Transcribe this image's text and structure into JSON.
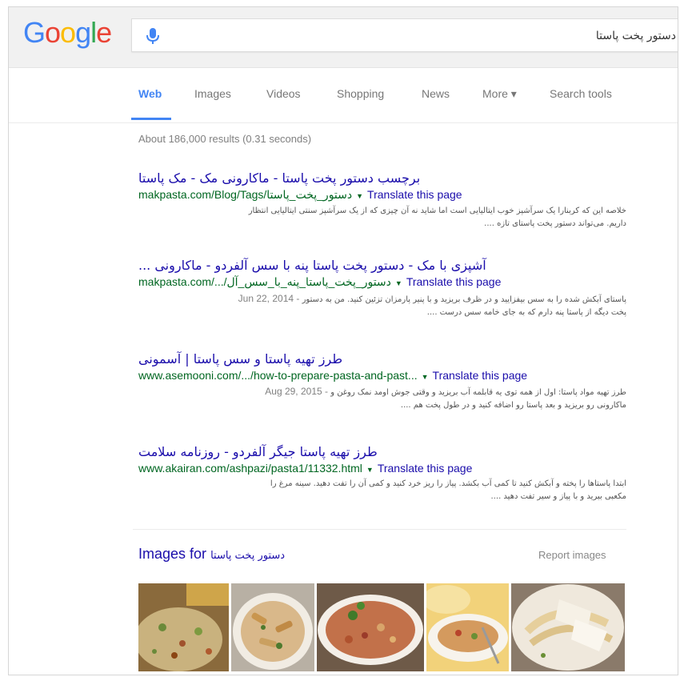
{
  "logo": "Google",
  "search": {
    "query": "دستور پخت پاستا"
  },
  "tabs": [
    {
      "label": "Web",
      "active": true
    },
    {
      "label": "Images",
      "active": false
    },
    {
      "label": "Videos",
      "active": false
    },
    {
      "label": "Shopping",
      "active": false
    },
    {
      "label": "News",
      "active": false
    },
    {
      "label": "More ▾",
      "active": false
    },
    {
      "label": "Search tools",
      "active": false
    }
  ],
  "result_stats": "About 186,000 results (0.31 seconds)",
  "results": [
    {
      "title": "برچسب دستور پخت پاستا - ماکارونی مک - مک پاستا",
      "url": "makpasta.com/Blog/Tags/دستور_پخت_پاستا",
      "translate": "Translate this page",
      "date": "",
      "snippet1": "خلاصه این که کربنارا یک سرآشپز خوب ایتالیایی است اما شاید نه آن چیزی که از یک سرآشپز سنتی ایتالیایی انتظار",
      "snippet2": "داریم. می‌تواند دستور پخت پاستای تازه ...."
    },
    {
      "title": "آشپزی با مک - دستور پخت پاستا پنه با سس آلفردو - ماکارونی ...",
      "url": "makpasta.com/.../دستور_پخت_پاستا_پنه_با_سس_آل",
      "translate": "Translate this page",
      "date": "Jun 22, 2014 -",
      "snippet1": "پاستای آبکش شده را به سس بیفزایید و در ظرف بریزید و با پنیر پارمزان تزئین کنید. من به دستور",
      "snippet2": "پخت دیگه از پاستا پنه دارم که به جای خامه سس درست ...."
    },
    {
      "title": "طرز تهیه پاستا و سس پاستا | آسمونی",
      "url": "www.asemooni.com/.../how-to-prepare-pasta-and-past...",
      "translate": "Translate this page",
      "date": "Aug 29, 2015 -",
      "snippet1": "طرز تهیه مواد پاستا: اول از همه توی یه قابلمه آب بریزید و وقتی جوش اومد نمک روغن و",
      "snippet2": "ماکارونی رو بریزید و بعد پاستا رو اضافه کنید و در طول پخت هم ...."
    },
    {
      "title": "طرز تهیه پاستا جیگر آلفردو - روزنامه سلامت",
      "url": "www.akairan.com/ashpazi/pasta1/11332.html",
      "translate": "Translate this page",
      "date": "",
      "snippet1": "ابتدا پاستاها را پخته و آبکش کنید تا کمی آب بکشد. پیاز را ریز خرد کنید و کمی آن را تفت دهید. سینه مرغ را",
      "snippet2": "مکعبی ببرید و با پیاز و سیر تفت دهید ...."
    }
  ],
  "images": {
    "heading_prefix": "Images for",
    "heading_query": "دستور پخت پاستا",
    "report": "Report images"
  },
  "colors": {
    "link": "#1a0dab",
    "url": "#006621",
    "accent": "#4285f4"
  }
}
